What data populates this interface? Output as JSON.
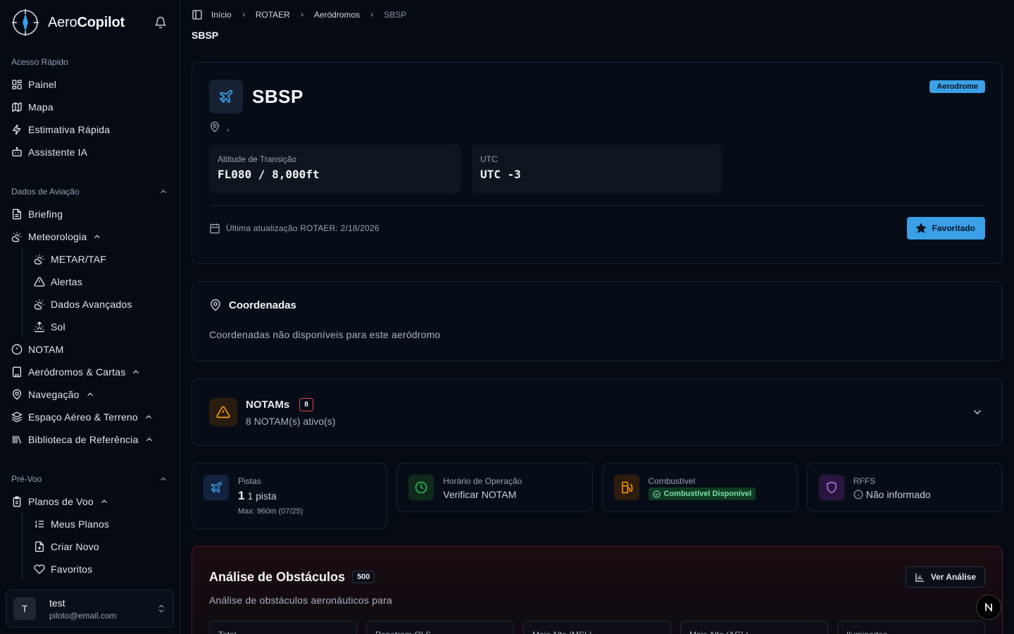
{
  "brand": {
    "name_light": "Aero",
    "name_bold": "Copilot"
  },
  "sidebar": {
    "quick_label": "Acesso Rápido",
    "quick_items": [
      {
        "label": "Painel",
        "icon": "grid-icon"
      },
      {
        "label": "Mapa",
        "icon": "map-icon"
      },
      {
        "label": "Estimativa Rápida",
        "icon": "bolt-icon"
      },
      {
        "label": "Assistente IA",
        "icon": "bot-icon"
      }
    ],
    "aviation_label": "Dados de Aviação",
    "briefing": "Briefing",
    "meteo": "Meteorologia",
    "meteo_sub": [
      "METAR/TAF",
      "Alertas",
      "Dados Avançados",
      "Sol"
    ],
    "notam": "NOTAM",
    "aerodromos": "Aeródromos & Cartas",
    "navegacao": "Navegação",
    "espaco": "Espaço Aéreo & Terreno",
    "biblioteca": "Biblioteca de Referência",
    "prevoo_label": "Pré-Voo",
    "planos": "Planos de Voo",
    "planos_sub": [
      "Meus Planos",
      "Criar Novo",
      "Favoritos"
    ]
  },
  "user": {
    "initial": "T",
    "name": "test",
    "email": "piloto@email.com"
  },
  "breadcrumb": [
    "Início",
    "ROTAER",
    "Aeródromos",
    "SBSP"
  ],
  "page_title": "SBSP",
  "aerodrome": {
    "code": "SBSP",
    "badge": "Aerodrome",
    "location": ",",
    "transition_label": "Altitude de Transição",
    "transition_value": "FL080 / 8,000ft",
    "utc_label": "UTC",
    "utc_value": "UTC -3",
    "updated": "Última atualização ROTAER: 2/18/2026",
    "fav_label": "Favoritado"
  },
  "coords": {
    "title": "Coordenadas",
    "text": "Coordenadas não disponíveis para este aeródromo"
  },
  "notams": {
    "title": "NOTAMs",
    "count": "8",
    "subtitle": "8 NOTAM(s) ativo(s)"
  },
  "info": {
    "pistas_label": "Pistas",
    "pistas_count": "1",
    "pistas_text": "1 pista",
    "pistas_max": "Max: 960m (07/25)",
    "horario_label": "Horário de Operação",
    "horario_val": "Verificar NOTAM",
    "fuel_label": "Combustível",
    "fuel_val": "Combustível Disponível",
    "rffs_label": "RFFS",
    "rffs_val": "Não informado"
  },
  "obstacles": {
    "title": "Análise de Obstáculos",
    "count": "500",
    "button": "Ver Análise",
    "subtitle": "Análise de obstáculos aeronáuticos para",
    "metrics": [
      "Total",
      "Penetram OLS",
      "Mais Alto (MSL)",
      "Mais Alto (AGL)",
      "Iluminados"
    ]
  },
  "colors": {
    "accent": "#3ba0e8",
    "warning": "#f59e0b",
    "success": "#22c55e",
    "danger": "#e0464c"
  }
}
